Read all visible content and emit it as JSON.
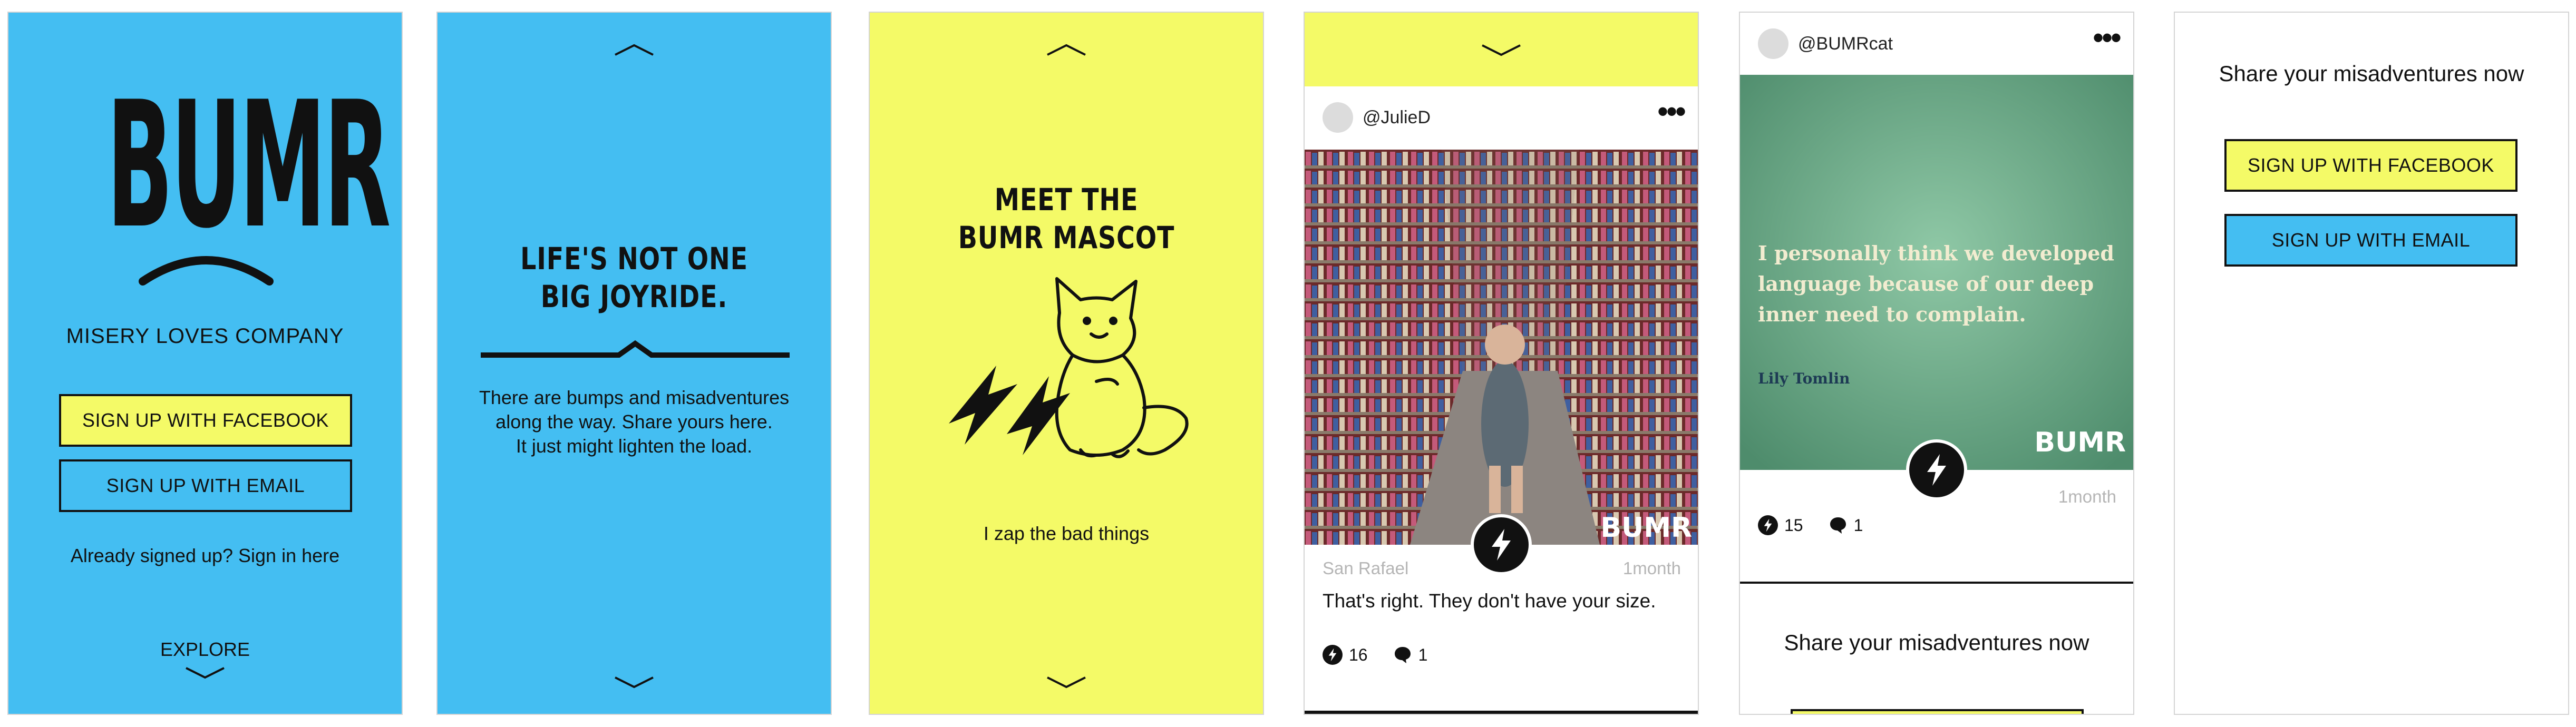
{
  "colors": {
    "blue": "#44bef2",
    "yellow": "#f4fa67",
    "black": "#111111"
  },
  "screen1": {
    "logo": "BUMR",
    "tagline": "MISERY LOVES COMPANY",
    "facebook_button": "SIGN UP WITH FACEBOOK",
    "email_button": "SIGN UP WITH EMAIL",
    "signin_link": "Already signed up? Sign in here",
    "explore": "EXPLORE"
  },
  "screen2": {
    "heading_line1": "LIFE'S NOT ONE",
    "heading_line2": "BIG JOYRIDE.",
    "body_line1": "There are bumps and misadventures",
    "body_line2": "along the way. Share yours here.",
    "body_line3": "It just might lighten the load."
  },
  "screen3": {
    "heading_line1": "MEET THE",
    "heading_line2": "BUMR MASCOT",
    "caption": "I zap the bad things"
  },
  "screen4": {
    "post": {
      "handle": "@JulieD",
      "location": "San Rafael",
      "time": "1month",
      "caption": "That's right. They don't have your size.",
      "zaps": "16",
      "comments": "1",
      "watermark": "BUMR"
    }
  },
  "screen5": {
    "post": {
      "handle": "@BUMRcat",
      "time": "1month",
      "zaps": "15",
      "comments": "1",
      "quote_line1": "I personally think we developed",
      "quote_line2": "language because of our deep",
      "quote_line3": "inner need to complain.",
      "quote_author": "Lily Tomlin",
      "watermark": "BUMR"
    },
    "share_prompt": "Share your misadventures now"
  },
  "screen6": {
    "share_prompt": "Share your misadventures now",
    "facebook_button": "SIGN UP WITH FACEBOOK",
    "email_button": "SIGN UP WITH EMAIL"
  },
  "icons": [
    "chevron-up-icon",
    "chevron-down-icon",
    "more-icon",
    "bolt-icon",
    "comment-icon",
    "frown-icon",
    "bump-line-icon",
    "mascot-cat-illustration"
  ]
}
